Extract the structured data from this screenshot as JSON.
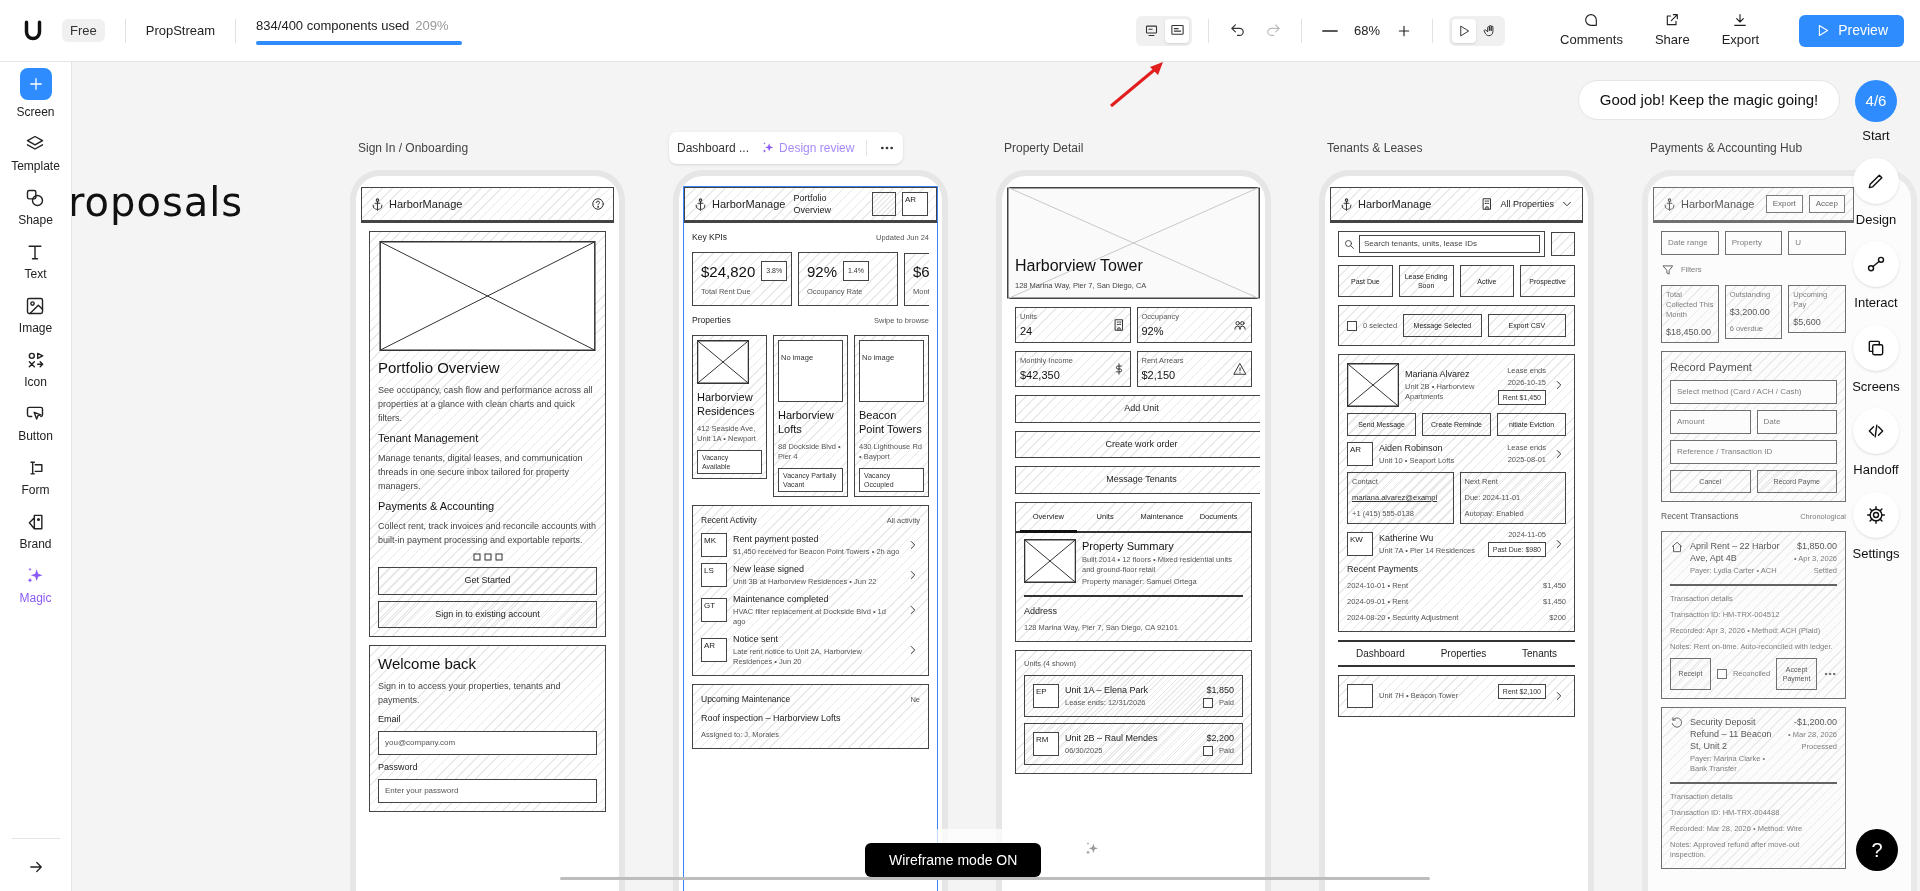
{
  "topbar": {
    "plan": "Free",
    "project": "PropStream",
    "usage": {
      "text": "834/400 components used",
      "percent": "209%",
      "level": 1
    },
    "view_toggle": [
      {
        "selected": false
      },
      {
        "selected": true
      }
    ],
    "mode_toggle": [
      {
        "selected": true
      },
      {
        "selected": false
      }
    ],
    "zoom": "68%",
    "actions": [
      "Comments",
      "Share",
      "Export"
    ],
    "preview": "Preview"
  },
  "sidebar": {
    "items": [
      {
        "label": "Screen",
        "selected": false
      },
      {
        "label": "Template",
        "selected": false
      },
      {
        "label": "Shape",
        "selected": false
      },
      {
        "label": "Text",
        "selected": false
      },
      {
        "label": "Image",
        "selected": false
      },
      {
        "label": "Icon",
        "selected": false
      },
      {
        "label": "Button",
        "selected": false
      },
      {
        "label": "Form",
        "selected": false
      },
      {
        "label": "Brand",
        "selected": false
      },
      {
        "label": "Magic",
        "selected": true
      }
    ]
  },
  "canvas_text": "roposals",
  "screens": [
    {
      "title": "Sign In / Onboarding",
      "selected": false,
      "dimmed": false,
      "blocks": [
        {
          "kind": "header",
          "logo": "HarborManage",
          "items": [
            {
              "kind": "help-icon"
            }
          ]
        },
        {
          "kind": "card",
          "children": [
            {
              "kind": "image"
            },
            {
              "kind": "title",
              "text": "Portfolio Overview"
            },
            {
              "kind": "text",
              "text": "See occupancy, cash flow and performance across all properties at a glance with clean charts and quick filters."
            },
            {
              "kind": "heading",
              "text": "Tenant Management"
            },
            {
              "kind": "text",
              "text": "Manage tenants, digital leases, and communication threads in one secure inbox tailored for property managers."
            },
            {
              "kind": "heading",
              "text": "Payments & Accounting"
            },
            {
              "kind": "text",
              "text": "Collect rent, track invoices and reconcile accounts with built-in payment processing and exportable reports."
            },
            {
              "kind": "dots"
            },
            {
              "kind": "button",
              "text": "Get Started"
            },
            {
              "kind": "button",
              "text": "Sign in to existing account"
            }
          ]
        },
        {
          "kind": "card",
          "children": [
            {
              "kind": "title",
              "text": "Welcome back"
            },
            {
              "kind": "text",
              "text": "Sign in to access your properties, tenants and payments."
            },
            {
              "kind": "label",
              "text": "Email"
            },
            {
              "kind": "field",
              "placeholder": "you@company.com"
            },
            {
              "kind": "label",
              "text": "Password"
            },
            {
              "kind": "field",
              "placeholder": "Enter your password"
            }
          ]
        }
      ]
    },
    {
      "title": "Dashboard ...",
      "review": "Design review",
      "selected": true,
      "dimmed": false,
      "blocks": [
        {
          "kind": "header",
          "logo": "HarborManage",
          "items": [
            {
              "kind": "label",
              "text": "Portfolio Overview"
            },
            {
              "kind": "blank-box"
            },
            {
              "kind": "avatar",
              "text": "AR"
            }
          ]
        },
        {
          "kind": "section",
          "title": "Key KPIs",
          "aside": "Updated Jun 24"
        },
        {
          "kind": "strip",
          "children": [
            {
              "kind": "tile",
              "children": [
                {
                  "kind": "row",
                  "children": [
                    {
                      "kind": "title",
                      "text": "$24,820"
                    },
                    {
                      "kind": "badge",
                      "text": "3.8%"
                    }
                  ]
                },
                {
                  "kind": "small",
                  "text": "Total Rent Due"
                }
              ]
            },
            {
              "kind": "tile",
              "children": [
                {
                  "kind": "row",
                  "children": [
                    {
                      "kind": "title",
                      "text": "92%"
                    },
                    {
                      "kind": "badge",
                      "text": "1.4%"
                    }
                  ]
                },
                {
                  "kind": "small",
                  "text": "Occupancy Rate"
                }
              ]
            },
            {
              "kind": "tile",
              "children": [
                {
                  "kind": "title",
                  "text": "$6"
                },
                {
                  "kind": "small",
                  "text": "Mont"
                }
              ]
            }
          ]
        },
        {
          "kind": "section",
          "title": "Properties",
          "aside": "Swipe to browse"
        },
        {
          "kind": "row",
          "top": true,
          "children": [
            {
              "kind": "card",
              "children": [
                {
                  "kind": "thumb"
                },
                {
                  "kind": "heading",
                  "text": "Harborview Residences"
                },
                {
                  "kind": "small",
                  "text": "412 Seaside Ave, Unit 1A • Newport"
                },
                {
                  "kind": "chip",
                  "text": "Vacancy Available"
                }
              ]
            },
            {
              "kind": "card",
              "children": [
                {
                  "kind": "no-image",
                  "text": "No image"
                },
                {
                  "kind": "heading",
                  "text": "Harborview Lofts"
                },
                {
                  "kind": "small",
                  "text": "88 Dockside Blvd • Pier 4"
                },
                {
                  "kind": "chip",
                  "text": "Vacancy Partially Vacant"
                }
              ]
            },
            {
              "kind": "card",
              "children": [
                {
                  "kind": "no-image",
                  "text": "No image"
                },
                {
                  "kind": "heading",
                  "text": "Beacon Point Towers"
                },
                {
                  "kind": "small",
                  "text": "430 Lighthouse Rd • Bayport"
                },
                {
                  "kind": "chip",
                  "text": "Vacancy Occupied"
                }
              ]
            }
          ]
        },
        {
          "kind": "card",
          "children": [
            {
              "kind": "section",
              "title": "Recent Activity",
              "aside": "All activity"
            },
            {
              "kind": "row",
              "children": [
                {
                  "kind": "avatar",
                  "text": "MK"
                },
                {
                  "kind": "col",
                  "children": [
                    {
                      "kind": "label",
                      "text": "Rent payment posted"
                    },
                    {
                      "kind": "small",
                      "text": "$1,450 received for Beacon Point Towers • 2h ago"
                    }
                  ]
                },
                {
                  "kind": "chevron-right-icon"
                }
              ]
            },
            {
              "kind": "row",
              "children": [
                {
                  "kind": "avatar",
                  "text": "LS"
                },
                {
                  "kind": "col",
                  "children": [
                    {
                      "kind": "label",
                      "text": "New lease signed"
                    },
                    {
                      "kind": "small",
                      "text": "Unit 3B at Harborview Residences • Jun 22"
                    }
                  ]
                },
                {
                  "kind": "chevron-right-icon"
                }
              ]
            },
            {
              "kind": "row",
              "children": [
                {
                  "kind": "avatar",
                  "text": "GT"
                },
                {
                  "kind": "col",
                  "children": [
                    {
                      "kind": "label",
                      "text": "Maintenance completed"
                    },
                    {
                      "kind": "small",
                      "text": "HVAC filter replacement at Dockside Blvd • 1d ago"
                    }
                  ]
                },
                {
                  "kind": "chevron-right-icon"
                }
              ]
            },
            {
              "kind": "row",
              "children": [
                {
                  "kind": "avatar",
                  "text": "AR"
                },
                {
                  "kind": "col",
                  "children": [
                    {
                      "kind": "label",
                      "text": "Notice sent"
                    },
                    {
                      "kind": "small",
                      "text": "Late rent notice to Unit 2A, Harborview Residences • Jun 20"
                    }
                  ]
                },
                {
                  "kind": "chevron-right-icon"
                }
              ]
            }
          ]
        },
        {
          "kind": "card",
          "children": [
            {
              "kind": "section",
              "title": "Upcoming Maintenance",
              "aside": "Ne"
            },
            {
              "kind": "label",
              "text": "Roof inspection – Harborview Lofts"
            },
            {
              "kind": "small",
              "text": "Assigned to: J. Morales"
            }
          ]
        }
      ]
    },
    {
      "title": "Property Detail",
      "selected": false,
      "dimmed": false,
      "blocks": [
        {
          "kind": "hero",
          "title": "Harborview Tower",
          "subtitle": "128 Marina Way, Pier 7, San Diego, CA"
        },
        {
          "kind": "row",
          "children": [
            {
              "kind": "card",
              "children": [
                {
                  "kind": "row",
                  "children": [
                    {
                      "kind": "col",
                      "children": [
                        {
                          "kind": "small",
                          "text": "Units"
                        },
                        {
                          "kind": "heading",
                          "text": "24"
                        }
                      ]
                    },
                    {
                      "kind": "building-icon"
                    }
                  ]
                }
              ]
            },
            {
              "kind": "card",
              "children": [
                {
                  "kind": "row",
                  "children": [
                    {
                      "kind": "col",
                      "children": [
                        {
                          "kind": "small",
                          "text": "Occupancy"
                        },
                        {
                          "kind": "heading",
                          "text": "92%"
                        }
                      ]
                    },
                    {
                      "kind": "people-icon"
                    }
                  ]
                }
              ]
            }
          ]
        },
        {
          "kind": "row",
          "children": [
            {
              "kind": "card",
              "children": [
                {
                  "kind": "row",
                  "children": [
                    {
                      "kind": "col",
                      "children": [
                        {
                          "kind": "small",
                          "text": "Monthly Income"
                        },
                        {
                          "kind": "heading",
                          "text": "$42,350"
                        }
                      ]
                    },
                    {
                      "kind": "dollar-icon"
                    }
                  ]
                }
              ]
            },
            {
              "kind": "card",
              "children": [
                {
                  "kind": "row",
                  "children": [
                    {
                      "kind": "col",
                      "children": [
                        {
                          "kind": "small",
                          "text": "Rent Arrears"
                        },
                        {
                          "kind": "heading",
                          "text": "$2,150"
                        }
                      ]
                    },
                    {
                      "kind": "warning-icon"
                    }
                  ]
                }
              ]
            }
          ]
        },
        {
          "kind": "button",
          "text": "Add Unit"
        },
        {
          "kind": "button",
          "text": "Create work order"
        },
        {
          "kind": "button",
          "text": "Message Tenants"
        },
        {
          "kind": "card",
          "children": [
            {
              "kind": "tabs",
              "items": [
                {
                  "label": "Overview",
                  "selected": true
                },
                {
                  "label": "Units",
                  "selected": false
                },
                {
                  "label": "Maintenance",
                  "selected": false
                },
                {
                  "label": "Documents",
                  "selected": false
                }
              ]
            },
            {
              "kind": "row",
              "top": true,
              "children": [
                {
                  "kind": "thumb"
                },
                {
                  "kind": "col",
                  "children": [
                    {
                      "kind": "heading",
                      "text": "Property Summary"
                    },
                    {
                      "kind": "small",
                      "text": "Built 2014 • 12 floors • Mixed residential units and ground-floor retail"
                    },
                    {
                      "kind": "small",
                      "text": "Property manager: Samuel Ortega"
                    }
                  ]
                }
              ]
            },
            {
              "kind": "rule"
            },
            {
              "kind": "label",
              "text": "Address"
            },
            {
              "kind": "small",
              "text": "128 Marina Way, Pier 7, San Diego, CA 92101"
            }
          ]
        },
        {
          "kind": "card",
          "children": [
            {
              "kind": "small",
              "text": "Units (4 shown)"
            },
            {
              "kind": "card",
              "children": [
                {
                  "kind": "row",
                  "children": [
                    {
                      "kind": "avatar",
                      "text": "EP"
                    },
                    {
                      "kind": "col",
                      "children": [
                        {
                          "kind": "label",
                          "text": "Unit 1A – Elena Park"
                        },
                        {
                          "kind": "small",
                          "text": "Lease ends: 12/31/2026"
                        }
                      ]
                    },
                    {
                      "kind": "aside",
                      "children": [
                        {
                          "kind": "label",
                          "text": "$1,850"
                        },
                        {
                          "kind": "row",
                          "children": [
                            {
                              "kind": "checkbox",
                              "checked": false
                            },
                            {
                              "kind": "small",
                              "text": "Paid"
                            }
                          ]
                        }
                      ]
                    }
                  ]
                }
              ]
            },
            {
              "kind": "card",
              "children": [
                {
                  "kind": "row",
                  "children": [
                    {
                      "kind": "avatar",
                      "text": "RM"
                    },
                    {
                      "kind": "col",
                      "children": [
                        {
                          "kind": "label",
                          "text": "Unit 2B – Raul Mendes"
                        },
                        {
                          "kind": "small",
                          "text": "06/30/2025"
                        }
                      ]
                    },
                    {
                      "kind": "aside",
                      "children": [
                        {
                          "kind": "label",
                          "text": "$2,200"
                        },
                        {
                          "kind": "row",
                          "children": [
                            {
                              "kind": "checkbox",
                              "checked": false
                            },
                            {
                              "kind": "small",
                              "text": "Paid"
                            }
                          ]
                        }
                      ]
                    }
                  ]
                }
              ]
            }
          ]
        }
      ]
    },
    {
      "title": "Tenants & Leases",
      "selected": false,
      "dimmed": false,
      "blocks": [
        {
          "kind": "header",
          "logo": "HarborManage",
          "items": [
            {
              "kind": "building-icon"
            },
            {
              "kind": "label",
              "text": "All Properties"
            },
            {
              "kind": "chevron-down-icon"
            }
          ]
        },
        {
          "kind": "row",
          "children": [
            {
              "kind": "search",
              "placeholder": "Search tenants, units, lease IDs"
            },
            {
              "kind": "blank-box"
            }
          ]
        },
        {
          "kind": "row",
          "children": [
            {
              "kind": "button",
              "text": "Past Due"
            },
            {
              "kind": "button",
              "text": "Lease Ending Soon"
            },
            {
              "kind": "button",
              "text": "Active"
            },
            {
              "kind": "button",
              "text": "Prospective"
            }
          ]
        },
        {
          "kind": "card",
          "children": [
            {
              "kind": "row",
              "children": [
                {
                  "kind": "checkbox",
                  "checked": false
                },
                {
                  "kind": "small",
                  "text": "0 selected"
                },
                {
                  "kind": "button",
                  "text": "Message Selected"
                },
                {
                  "kind": "button",
                  "text": "Export CSV"
                }
              ]
            }
          ]
        },
        {
          "kind": "card",
          "children": [
            {
              "kind": "row",
              "children": [
                {
                  "kind": "thumb"
                },
                {
                  "kind": "col",
                  "children": [
                    {
                      "kind": "label",
                      "text": "Mariana Alvarez"
                    },
                    {
                      "kind": "small",
                      "text": "Unit 2B • Harborview Apartments"
                    }
                  ]
                },
                {
                  "kind": "aside",
                  "children": [
                    {
                      "kind": "small",
                      "text": "Lease ends"
                    },
                    {
                      "kind": "small",
                      "text": "2026-10-15"
                    },
                    {
                      "kind": "chip",
                      "text": "Rent $1,450"
                    }
                  ]
                },
                {
                  "kind": "chevron-right-icon"
                }
              ]
            },
            {
              "kind": "row",
              "children": [
                {
                  "kind": "button",
                  "text": "Send Message"
                },
                {
                  "kind": "button",
                  "text": "Create Reminde"
                },
                {
                  "kind": "button",
                  "text": "nitiate Eviction"
                }
              ]
            },
            {
              "kind": "row",
              "children": [
                {
                  "kind": "avatar",
                  "text": "AR"
                },
                {
                  "kind": "col",
                  "children": [
                    {
                      "kind": "label",
                      "text": "Aiden Robinson"
                    },
                    {
                      "kind": "small",
                      "text": "Unit 10 • Seaport Lofts"
                    }
                  ]
                },
                {
                  "kind": "aside",
                  "children": [
                    {
                      "kind": "small",
                      "text": "Lease ends"
                    },
                    {
                      "kind": "small",
                      "text": "2025-08-01"
                    }
                  ]
                },
                {
                  "kind": "chevron-right-icon"
                }
              ]
            },
            {
              "kind": "row",
              "children": [
                {
                  "kind": "card",
                  "children": [
                    {
                      "kind": "small",
                      "text": "Contact"
                    },
                    {
                      "kind": "link",
                      "text": "mariana.alvarez@exampl"
                    },
                    {
                      "kind": "small",
                      "text": "+1 (415) 555-0138"
                    }
                  ]
                },
                {
                  "kind": "card",
                  "children": [
                    {
                      "kind": "small",
                      "text": "Next Rent"
                    },
                    {
                      "kind": "small",
                      "text": "Due: 2024-11-01"
                    },
                    {
                      "kind": "small",
                      "text": "Autopay: Enabled"
                    }
                  ]
                }
              ]
            },
            {
              "kind": "row",
              "children": [
                {
                  "kind": "avatar",
                  "text": "KW"
                },
                {
                  "kind": "col",
                  "children": [
                    {
                      "kind": "label",
                      "text": "Katherine Wu"
                    },
                    {
                      "kind": "small",
                      "text": "Unit 7A • Pier 14 Residences"
                    }
                  ]
                },
                {
                  "kind": "aside",
                  "children": [
                    {
                      "kind": "small",
                      "text": "2024-11-05"
                    },
                    {
                      "kind": "chip",
                      "text": "Past Due: $980"
                    }
                  ]
                },
                {
                  "kind": "chevron-right-icon"
                }
              ]
            },
            {
              "kind": "label",
              "text": "Recent Payments"
            },
            {
              "kind": "row",
              "children": [
                {
                  "kind": "col",
                  "children": [
                    {
                      "kind": "small",
                      "text": "2024-10-01 • Rent"
                    }
                  ]
                },
                {
                  "kind": "small",
                  "text": "$1,450"
                }
              ]
            },
            {
              "kind": "row",
              "children": [
                {
                  "kind": "col",
                  "children": [
                    {
                      "kind": "small",
                      "text": "2024-09-01 • Rent"
                    }
                  ]
                },
                {
                  "kind": "small",
                  "text": "$1,450"
                }
              ]
            },
            {
              "kind": "row",
              "children": [
                {
                  "kind": "col",
                  "children": [
                    {
                      "kind": "small",
                      "text": "2024-08-20 • Security Adjustment"
                    }
                  ]
                },
                {
                  "kind": "small",
                  "text": "$200"
                }
              ]
            }
          ]
        },
        {
          "kind": "navbar",
          "items": [
            "Dashboard",
            "Properties",
            "Tenants"
          ]
        },
        {
          "kind": "card",
          "children": [
            {
              "kind": "row",
              "children": [
                {
                  "kind": "avatar"
                },
                {
                  "kind": "col",
                  "children": [
                    {
                      "kind": "small",
                      "text": "Unit 7H • Beacon Tower"
                    }
                  ]
                },
                {
                  "kind": "chip",
                  "text": "Rent $2,100"
                },
                {
                  "kind": "chevron-right-icon"
                }
              ]
            }
          ]
        }
      ]
    },
    {
      "title": "Payments & Accounting Hub",
      "selected": false,
      "dimmed": true,
      "blocks": [
        {
          "kind": "header",
          "logo": "HarborManage",
          "items": [
            {
              "kind": "mini-button",
              "text": "Export"
            },
            {
              "kind": "mini-button",
              "text": "Accep"
            }
          ]
        },
        {
          "kind": "row",
          "children": [
            {
              "kind": "field",
              "placeholder": "Date range"
            },
            {
              "kind": "field",
              "placeholder": "Property"
            },
            {
              "kind": "field",
              "placeholder": "U"
            }
          ]
        },
        {
          "kind": "row",
          "children": [
            {
              "kind": "filter-icon"
            },
            {
              "kind": "small",
              "text": "Filters"
            }
          ]
        },
        {
          "kind": "row",
          "top": true,
          "children": [
            {
              "kind": "card",
              "children": [
                {
                  "kind": "small",
                  "text": "Total Collected This Month"
                },
                {
                  "kind": "label",
                  "text": "$18,450.00"
                }
              ]
            },
            {
              "kind": "card",
              "children": [
                {
                  "kind": "small",
                  "text": "Outstanding"
                },
                {
                  "kind": "label",
                  "text": "$3,200.00"
                },
                {
                  "kind": "small",
                  "text": "6 overdue"
                }
              ]
            },
            {
              "kind": "card",
              "children": [
                {
                  "kind": "small",
                  "text": "Upcoming Pay"
                },
                {
                  "kind": "label",
                  "text": "$5,600"
                }
              ]
            }
          ]
        },
        {
          "kind": "card",
          "children": [
            {
              "kind": "heading",
              "text": "Record Payment"
            },
            {
              "kind": "field",
              "placeholder": "Select method (Card / ACH / Cash)"
            },
            {
              "kind": "row",
              "children": [
                {
                  "kind": "field",
                  "placeholder": "Amount"
                },
                {
                  "kind": "field",
                  "placeholder": "Date"
                }
              ]
            },
            {
              "kind": "field",
              "placeholder": "Reference / Transaction ID"
            },
            {
              "kind": "row",
              "children": [
                {
                  "kind": "button",
                  "text": "Cancel"
                },
                {
                  "kind": "button",
                  "text": "Record Payme"
                }
              ]
            }
          ]
        },
        {
          "kind": "section",
          "title": "Recent Transactions",
          "aside": "Chronological"
        },
        {
          "kind": "card",
          "children": [
            {
              "kind": "row",
              "top": true,
              "children": [
                {
                  "kind": "house-icon"
                },
                {
                  "kind": "col",
                  "children": [
                    {
                      "kind": "label",
                      "text": "April Rent – 22 Harbor Ave, Apt 4B"
                    },
                    {
                      "kind": "small",
                      "text": "Payer: Lydia Carter • ACH"
                    }
                  ]
                },
                {
                  "kind": "aside",
                  "children": [
                    {
                      "kind": "label",
                      "text": "$1,850.00"
                    },
                    {
                      "kind": "small",
                      "text": "• Apr 3, 2026"
                    },
                    {
                      "kind": "small",
                      "text": "Settled"
                    }
                  ]
                }
              ]
            },
            {
              "kind": "rule"
            },
            {
              "kind": "small",
              "text": "Transaction details"
            },
            {
              "kind": "small",
              "text": "Transaction ID: HM-TRX-004512"
            },
            {
              "kind": "small",
              "text": "Recorded: Apr 3, 2026 • Method: ACH (Plaid)"
            },
            {
              "kind": "small",
              "text": "Notes: Rent on-time. Auto-reconciled with ledger."
            },
            {
              "kind": "row",
              "children": [
                {
                  "kind": "button",
                  "text": "Receipt"
                },
                {
                  "kind": "checkbox",
                  "checked": false
                },
                {
                  "kind": "small",
                  "text": "Reconciled"
                },
                {
                  "kind": "button",
                  "text": "Accept Payment"
                },
                {
                  "kind": "more-icon"
                }
              ]
            }
          ]
        },
        {
          "kind": "card",
          "children": [
            {
              "kind": "row",
              "top": true,
              "children": [
                {
                  "kind": "refund-icon"
                },
                {
                  "kind": "col",
                  "children": [
                    {
                      "kind": "label",
                      "text": "Security Deposit Refund – 11 Beacon St, Unit 2"
                    },
                    {
                      "kind": "small",
                      "text": "Payer: Marina Clarke • Bank Transfer"
                    }
                  ]
                },
                {
                  "kind": "aside",
                  "children": [
                    {
                      "kind": "label",
                      "text": "-$1,200.00"
                    },
                    {
                      "kind": "small",
                      "text": "• Mar 28, 2026"
                    },
                    {
                      "kind": "small",
                      "text": "Processed"
                    }
                  ]
                }
              ]
            },
            {
              "kind": "rule"
            },
            {
              "kind": "small",
              "text": "Transaction details"
            },
            {
              "kind": "small",
              "text": "Transaction ID: HM-TRX-004488"
            },
            {
              "kind": "small",
              "text": "Recorded: Mar 28, 2026 • Method: Wire"
            },
            {
              "kind": "small",
              "text": "Notes: Approved refund after move-out inspection."
            }
          ]
        }
      ]
    }
  ],
  "assistant": {
    "message": "Good job! Keep the magic going!",
    "progress": "4/6",
    "start": "Start",
    "tools": [
      "Design",
      "Interact",
      "Screens",
      "Handoff",
      "Settings"
    ],
    "help": "?"
  },
  "status_pill": "Wireframe mode ON"
}
